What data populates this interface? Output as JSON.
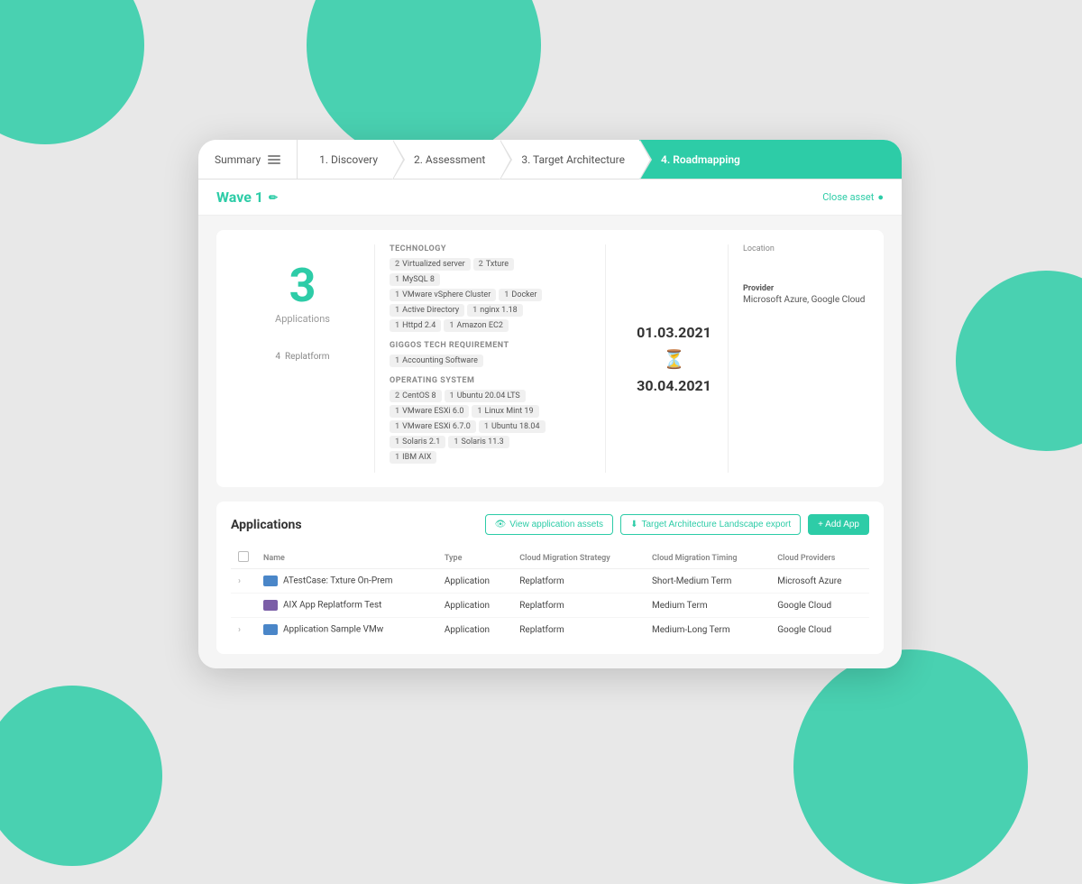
{
  "background": {
    "color": "#e8e8e8",
    "accent": "#2dcca7"
  },
  "nav": {
    "summary_label": "Summary",
    "tabs": [
      {
        "id": "discovery",
        "label": "1. Discovery",
        "active": false
      },
      {
        "id": "assessment",
        "label": "2. Assessment",
        "active": false
      },
      {
        "id": "target_architecture",
        "label": "3. Target Architecture",
        "active": false
      },
      {
        "id": "roadmapping",
        "label": "4. Roadmapping",
        "active": true
      }
    ]
  },
  "sub_header": {
    "wave_label": "Wave 1",
    "edit_icon": "✏",
    "close_label": "Close asset",
    "close_icon": "●"
  },
  "summary": {
    "applications_count": "3",
    "applications_label": "Applications",
    "replatform_count": "4",
    "replatform_label": "Replatform",
    "technology": {
      "section_title": "TECHNOLOGY",
      "rows": [
        [
          {
            "count": "2",
            "label": "Virtualized server"
          },
          {
            "count": "2",
            "label": "Txture"
          }
        ],
        [
          {
            "count": "1",
            "label": "MySQL 8"
          }
        ],
        [
          {
            "count": "1",
            "label": "VMware vSphere Cluster"
          },
          {
            "count": "1",
            "label": "Docker"
          }
        ],
        [
          {
            "count": "1",
            "label": "Active Directory"
          },
          {
            "count": "1",
            "label": "nginx 1.18"
          }
        ],
        [
          {
            "count": "1",
            "label": "Httpd 2.4"
          },
          {
            "count": "1",
            "label": "Amazon EC2"
          }
        ]
      ]
    },
    "giggos_tech": {
      "section_title": "GIGGOS TECH REQUIREMENT",
      "rows": [
        [
          {
            "count": "1",
            "label": "Accounting Software"
          }
        ]
      ]
    },
    "operating_system": {
      "section_title": "OPERATING SYSTEM",
      "rows": [
        [
          {
            "count": "2",
            "label": "CentOS 8"
          },
          {
            "count": "1",
            "label": "Ubuntu 20.04 LTS"
          }
        ],
        [
          {
            "count": "1",
            "label": "VMware ESXi 6.0"
          },
          {
            "count": "1",
            "label": "Linux Mint 19"
          }
        ],
        [
          {
            "count": "1",
            "label": "VMware ESXi 6.7.0"
          },
          {
            "count": "1",
            "label": "Ubuntu 18.04"
          }
        ],
        [
          {
            "count": "1",
            "label": "Solaris 2.1"
          },
          {
            "count": "1",
            "label": "Solaris 11.3"
          }
        ],
        [
          {
            "count": "1",
            "label": "IBM AIX"
          }
        ]
      ]
    },
    "date_start": "01.03.2021",
    "date_end": "30.04.2021",
    "location_label": "Location",
    "provider_label": "Provider",
    "provider_value": "Microsoft Azure, Google Cloud"
  },
  "applications": {
    "section_title": "Applications",
    "view_assets_btn": "View application assets",
    "export_btn": "Target Architecture Landscape export",
    "add_btn": "+ Add App",
    "columns": [
      "",
      "Name",
      "Type",
      "Cloud Migration Strategy",
      "Cloud Migration Timing",
      "Cloud Providers"
    ],
    "rows": [
      {
        "has_chevron": true,
        "icon_color": "blue",
        "name": "ATestCase: Txture On-Prem",
        "type": "Application",
        "strategy": "Replatform",
        "timing": "Short-Medium Term",
        "providers": "Microsoft Azure"
      },
      {
        "has_chevron": false,
        "icon_color": "purple",
        "name": "AIX App Replatform Test",
        "type": "Application",
        "strategy": "Replatform",
        "timing": "Medium Term",
        "providers": "Google Cloud"
      },
      {
        "has_chevron": true,
        "icon_color": "blue",
        "name": "Application Sample VMw",
        "type": "Application",
        "strategy": "Replatform",
        "timing": "Medium-Long Term",
        "providers": "Google Cloud"
      }
    ]
  }
}
